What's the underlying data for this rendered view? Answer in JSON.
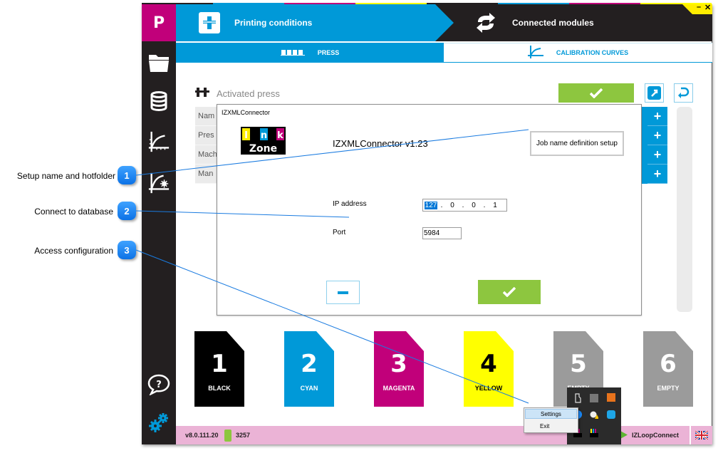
{
  "callouts": [
    {
      "number": "1",
      "label": "Setup name and hotfolder"
    },
    {
      "number": "2",
      "label": "Connect to database"
    },
    {
      "number": "3",
      "label": "Access configuration"
    }
  ],
  "app": {
    "logo_letter": "P",
    "header": {
      "tab_printing": "Printing conditions",
      "tab_connected": "Connected modules"
    },
    "window_controls": {
      "minimize": "–",
      "close": "✕"
    },
    "subtabs": {
      "press": "PRESS",
      "calibration": "CALIBRATION CURVES"
    },
    "sidebar": {
      "items": [
        {
          "icon": "folder-icon",
          "label": "Open"
        },
        {
          "icon": "database-icon",
          "label": "Database"
        },
        {
          "icon": "calibration-curve-icon",
          "label": "Calibration curves"
        },
        {
          "icon": "curve-settings-icon",
          "label": "Curve settings"
        }
      ],
      "help_icon": "help-icon",
      "settings_icon": "settings-gears-icon"
    },
    "content": {
      "section_title": "Activated press",
      "row_labels": [
        "Nam",
        "Pres",
        "Mach",
        "Man"
      ],
      "plus_label": "+"
    },
    "inks": [
      {
        "number": "1",
        "name": "BLACK",
        "color": "#000000",
        "text_color": "#ffffff"
      },
      {
        "number": "2",
        "name": "CYAN",
        "color": "#0099d8",
        "text_color": "#ffffff"
      },
      {
        "number": "3",
        "name": "MAGENTA",
        "color": "#c1007a",
        "text_color": "#ffffff"
      },
      {
        "number": "4",
        "name": "YELLOW",
        "color": "#ffff00",
        "text_color": "#000000"
      },
      {
        "number": "5",
        "name": "EMPTY",
        "color": "#9b9b9b",
        "text_color": "#ffffff"
      },
      {
        "number": "6",
        "name": "EMPTY",
        "color": "#9b9b9b",
        "text_color": "#ffffff"
      }
    ],
    "statusbar": {
      "version": "v8.0.111.20",
      "license_count": "3257",
      "connection": "IZLoopConnect"
    }
  },
  "dialog": {
    "title": "IZXMLConnector",
    "logo_text": {
      "i": "I",
      "n": "n",
      "k": "k",
      "zone": "Zone"
    },
    "version": "IZXMLConnector v1.23",
    "job_name_button": "Job name definition setup",
    "ip_label": "IP address",
    "ip_octets": [
      "127",
      "0",
      "0",
      "1"
    ],
    "port_label": "Port",
    "port_value": "5984"
  },
  "context_menu": {
    "items": [
      "Settings",
      "Exit"
    ]
  },
  "colors": {
    "cyan": "#0099d8",
    "magenta": "#c1007a",
    "yellow": "#ffff00",
    "green": "#8dc63f",
    "dark": "#231f20",
    "statusbar": "#ebb3d6",
    "callout": "#1a8cff"
  }
}
